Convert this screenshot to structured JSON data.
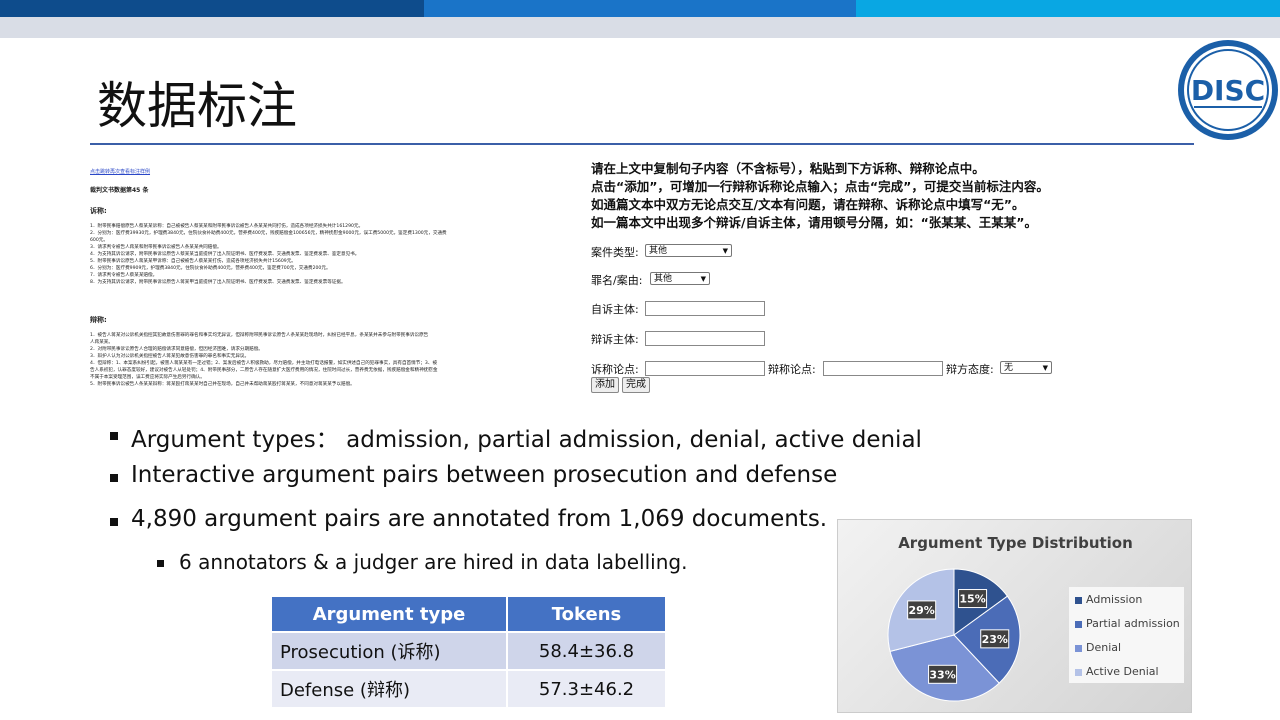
{
  "slide": {
    "title": "数据标注",
    "logo_text": "DISC"
  },
  "annotation_page": {
    "top_link": "点击跳转再次查看标注样例",
    "doc_number": "裁判文书数据第45 条",
    "prosecution_heading": "诉称:",
    "prosecution_lines": [
      "1．附带民事赔偿原告人蔡某某诉称：自己被被告人蔡某某和附带民事诉讼被告人条某某共同打伤，造成各项经济损失共计161290元。",
      "2．分别为：医疗费39930元，护理费3840元，住院伙食补助费400元，营养费400元，残疾赔偿金100656元，精神抚慰金9000元，误工费5000元，鉴定费1300元，交通费",
      "600元。",
      "3．请求判令被告人蒋某和附带民事诉讼被告人条某某共同赔偿。",
      "4．为支持其诉讼请求，附带民事诉讼原告人蔡某某当庭提供了出入院证明书、医疗费发票、交通费发票、鉴定费发票、鉴定意见书。",
      "5．附带民事诉讼原告人蒋某某甲诉称：自己被被告人蔡某某打伤，造成各项经济损失共计15609元。",
      "6．分别为：医疗费9909元，护理费3840元，住院伙食补助费400元，营养费400元，鉴定费700元，交通费200元。",
      "7．请求判令被告人蔡某某赔偿。",
      "8．为支持其诉讼请求，附带民事诉讼原告人蒋某甲当庭提供了出入院证明书、医疗费发票、交通费发票、鉴定费发票等证据。"
    ],
    "defense_heading": "辩称:",
    "defense_lines": [
      "1．被告人蒋某对公诉机关指控其犯故意伤害罪的罪名和事实均无异议，但辩称附带民事诉讼原告人条某某赴现场时，纠纷已经平息，条某某并未参与附带民事诉讼原告",
      "人蒋某某。",
      "2．对附带民事诉讼原告人合理的赔偿请求同意赔偿，但因经济困难，请求分期赔偿。",
      "3．辩护人认为对公诉机关指控被告人蒋某犯故意伤害罪的罪名和事实无异议。",
      "4．但辩称：1、本案系纠纷引起，被害人蒋某某有一定过错；2、案发后被告人积极救助，尽力赔偿，并主动打电话报警，如实供述自己的犯罪事实，具有自首情节；3、被",
      "告人系初犯，认罪态度较好，建议对被告人从轻处罚；4、附带民事部分，二原告人存在随意扩大医疗费用的情况，住院时间过长，营养费无依据，残疾赔偿金和精神抚慰金",
      "不属于本案受理范围，误工费应将实际产生后另行确认。",
      "5．附带民事诉讼被告人条某某辩称：蒋某殴打蒋某某时自己并在现场，自己并未帮助蒋某殴打蒋某某，不同意对蒋某某予以赔偿。"
    ],
    "instructions": [
      "请在上文中复制句子内容（不含标号），粘贴到下方诉称、辩称论点中。",
      "点击“添加”，可增加一行辩称诉称论点输入；点击“完成”，可提交当前标注内容。",
      "如通篇文本中双方无论点交互/文本有问题，请在辩称、诉称论点中填写“无”。",
      "如一篇本文中出现多个辩诉/自诉主体，请用顿号分隔，如：“张某某、王某某”。"
    ],
    "form": {
      "case_type_label": "案件类型:",
      "case_type_value": "其他",
      "charge_label": "罪名/案由:",
      "charge_value": "其他",
      "plaintiff_label": "自诉主体:",
      "plaintiff_value": "",
      "defendant_label": "辩诉主体:",
      "defendant_value": "",
      "claim_label": "诉称论点:",
      "claim_value": "",
      "defense_label": "辩称论点:",
      "defense_value": "",
      "attitude_label": "辩方态度:",
      "attitude_value": "无",
      "add_button": "添加",
      "finish_button": "完成"
    }
  },
  "bullets": [
    "Argument types：  admission, partial admission, denial, active denial",
    "Interactive argument pairs between prosecution and defense",
    "4,890 argument pairs are annotated from 1,069 documents."
  ],
  "sub_bullet": "6 annotators & a judger are hired in data labelling.",
  "table": {
    "headers": [
      "Argument type",
      "Tokens"
    ],
    "rows": [
      [
        "Prosecution (诉称)",
        "58.4±36.8"
      ],
      [
        "Defense (辩称)",
        "57.3±46.2"
      ]
    ]
  },
  "chart_data": {
    "type": "pie",
    "title": "Argument Type Distribution",
    "categories": [
      "Admission",
      "Partial admission",
      "Denial",
      "Active Denial"
    ],
    "values": [
      15,
      23,
      33,
      29
    ],
    "labels": [
      "15%",
      "23%",
      "33%",
      "29%"
    ],
    "colors": [
      "#2f528f",
      "#4b6cb7",
      "#7b93d6",
      "#b4c2e7"
    ],
    "legend_position": "right"
  }
}
